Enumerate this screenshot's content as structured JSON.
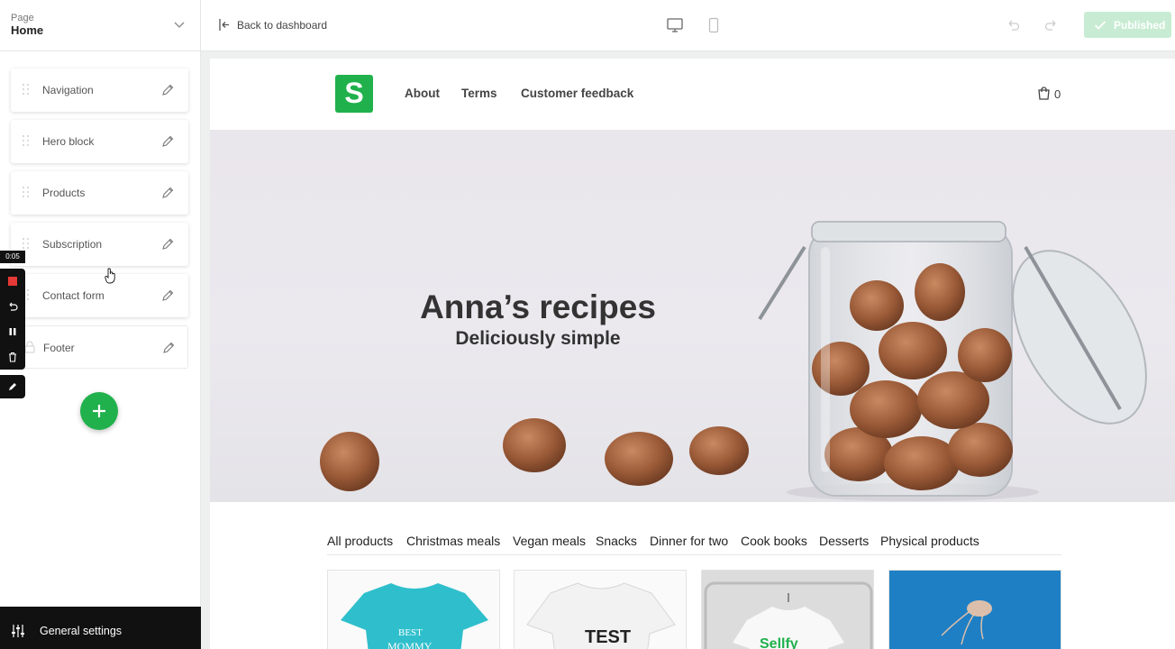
{
  "sidebar": {
    "page_label": "Page",
    "page_name": "Home",
    "blocks": [
      {
        "label": "Navigation"
      },
      {
        "label": "Hero block"
      },
      {
        "label": "Products"
      },
      {
        "label": "Subscription"
      },
      {
        "label": "Contact form"
      },
      {
        "label": "Footer"
      }
    ],
    "general_settings": "General settings"
  },
  "recorder": {
    "time": "0:05"
  },
  "topbar": {
    "back_label": "Back to dashboard",
    "published_label": "Published"
  },
  "site": {
    "logo_letter": "S",
    "nav": [
      "About",
      "Terms",
      "Customer feedback"
    ],
    "cart_count": "0",
    "hero_title": "Anna’s recipes",
    "hero_subtitle": "Deliciously simple",
    "categories": [
      "All products",
      "Christmas meals",
      "Vegan meals",
      "Snacks",
      "Dinner for two",
      "Cook books",
      "Desserts",
      "Physical products"
    ],
    "product_images": [
      {
        "text_line1": "BEST",
        "text_line2": "MOMMY",
        "color": "#2fbfcc"
      },
      {
        "text_line1": "TEST",
        "color": "#f4f4f4"
      },
      {
        "text_line1": "Sellfy",
        "color": "#20b14c"
      },
      {
        "color": "#1e7fc4"
      }
    ]
  },
  "colors": {
    "brand_green": "#20b14c",
    "published_bg": "#c8ecd3"
  }
}
